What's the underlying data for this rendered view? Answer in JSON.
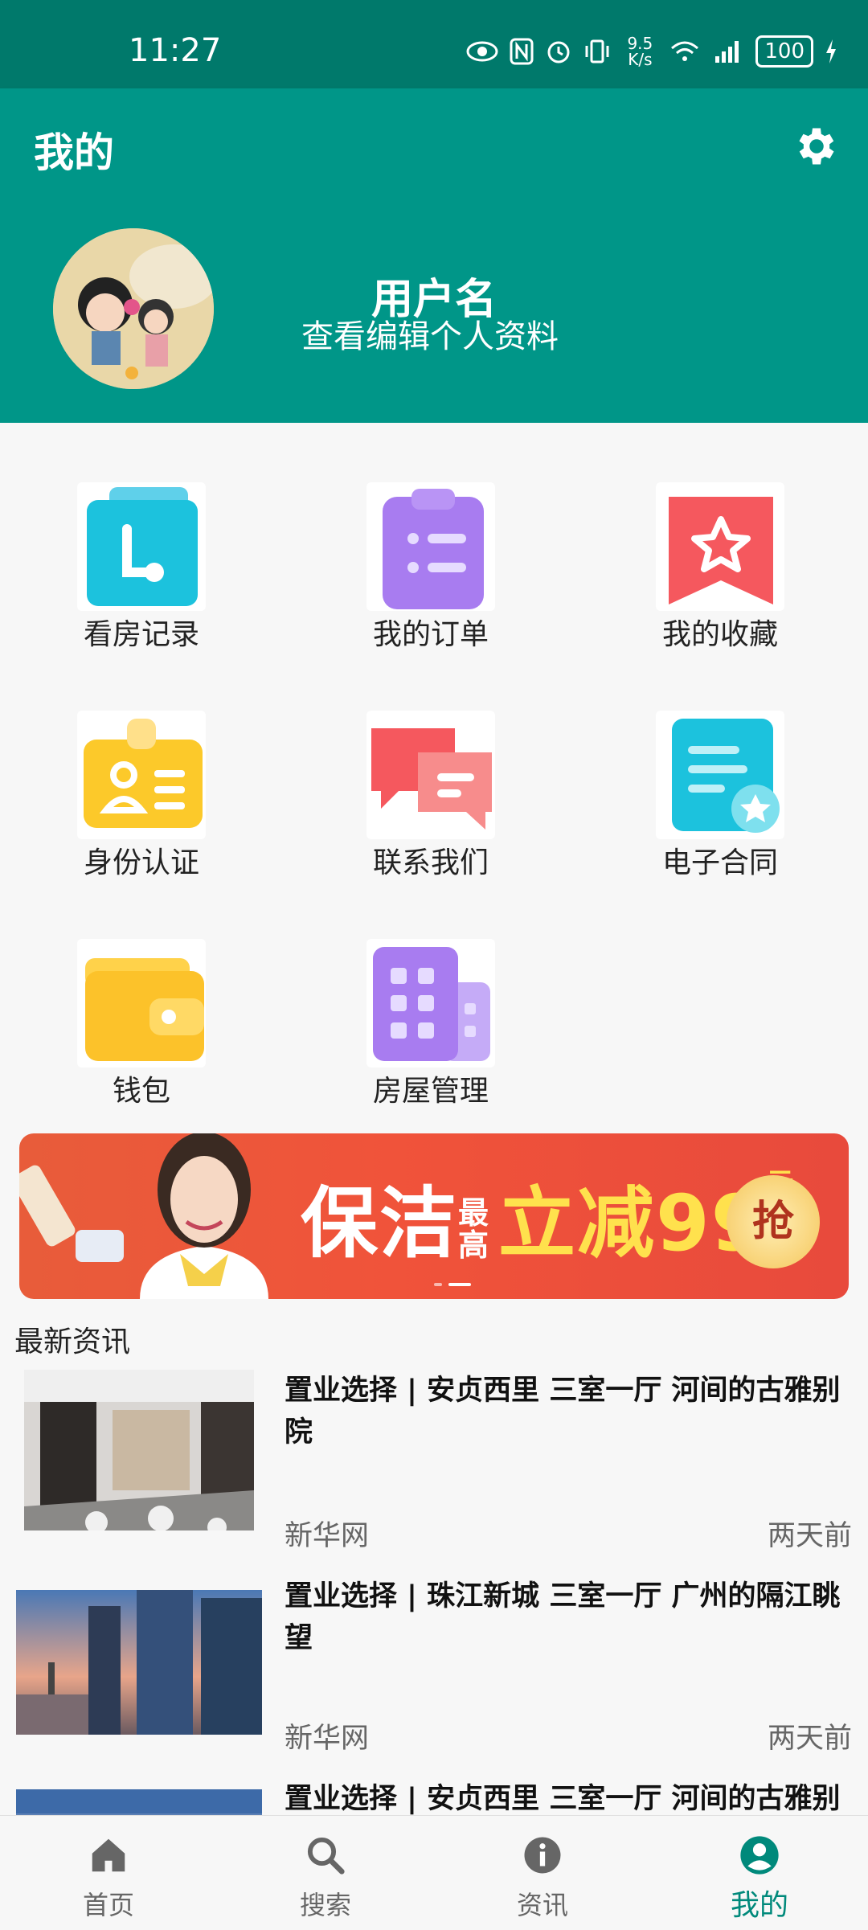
{
  "status": {
    "time": "11:27",
    "net_speed": "9.5 K/s",
    "battery": "100"
  },
  "appbar": {
    "title": "我的",
    "settings_icon": "gear-icon"
  },
  "profile": {
    "username": "用户名",
    "edit_link": "查看编辑个人资料"
  },
  "menu": [
    {
      "label": "看房记录",
      "icon": "clock-icon"
    },
    {
      "label": "我的订单",
      "icon": "clipboard-list-icon"
    },
    {
      "label": "我的收藏",
      "icon": "star-bookmark-icon"
    },
    {
      "label": "身份认证",
      "icon": "id-card-icon"
    },
    {
      "label": "联系我们",
      "icon": "chat-bubbles-icon"
    },
    {
      "label": "电子合同",
      "icon": "contract-icon"
    },
    {
      "label": "钱包",
      "icon": "wallet-icon"
    },
    {
      "label": "房屋管理",
      "icon": "building-icon"
    }
  ],
  "banner": {
    "promo_a": "保洁",
    "promo_small": "最高",
    "promo_b": "立减99",
    "promo_unit": "元",
    "grab": "抢"
  },
  "news_section": {
    "title": "最新资讯"
  },
  "news": [
    {
      "headline": "置业选择 | 安贞西里 三室一厅 河间的古雅别院",
      "source": "新华网",
      "when": "两天前"
    },
    {
      "headline": "置业选择 | 珠江新城 三室一厅 广州的隔江眺望",
      "source": "新华网",
      "when": "两天前"
    },
    {
      "headline": "置业选择 | 安贞西里 三室一厅 河间的古雅别"
    }
  ],
  "bottom_nav": [
    {
      "label": "首页",
      "icon": "home-icon"
    },
    {
      "label": "搜索",
      "icon": "search-icon"
    },
    {
      "label": "资讯",
      "icon": "info-icon"
    },
    {
      "label": "我的",
      "icon": "person-icon"
    }
  ],
  "colors": {
    "primary": "#009688",
    "status": "#00796b",
    "active_tab": "#00897b"
  }
}
